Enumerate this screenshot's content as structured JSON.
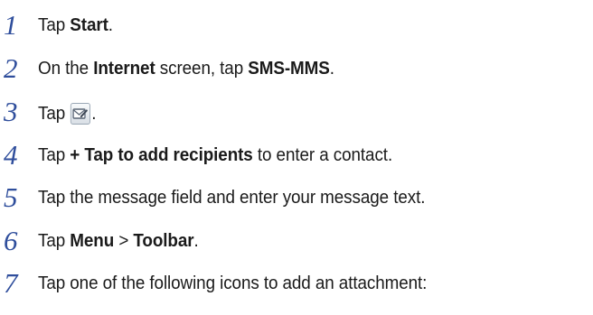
{
  "steps": [
    {
      "number": "1",
      "parts": [
        {
          "t": "Tap "
        },
        {
          "t": "Start",
          "b": true
        },
        {
          "t": "."
        }
      ]
    },
    {
      "number": "2",
      "parts": [
        {
          "t": "On the "
        },
        {
          "t": "Internet",
          "b": true
        },
        {
          "t": " screen, tap "
        },
        {
          "t": "SMS-MMS",
          "b": true
        },
        {
          "t": "."
        }
      ]
    },
    {
      "number": "3",
      "parts": [
        {
          "t": "Tap "
        },
        {
          "icon": "new-message-icon"
        },
        {
          "t": "."
        }
      ]
    },
    {
      "number": "4",
      "parts": [
        {
          "t": "Tap "
        },
        {
          "t": "+ Tap to add recipients",
          "b": true
        },
        {
          "t": " to enter a contact."
        }
      ]
    },
    {
      "number": "5",
      "parts": [
        {
          "t": "Tap the message field and enter your message text."
        }
      ]
    },
    {
      "number": "6",
      "parts": [
        {
          "t": "Tap "
        },
        {
          "t": "Menu",
          "b": true
        },
        {
          "t": " > "
        },
        {
          "t": "Toolbar",
          "b": true
        },
        {
          "t": "."
        }
      ]
    },
    {
      "number": "7",
      "parts": [
        {
          "t": "Tap one of the following icons to add an attachment:"
        }
      ]
    }
  ],
  "colors": {
    "step_number": "#2f4e9c",
    "text": "#1a1a1a"
  }
}
